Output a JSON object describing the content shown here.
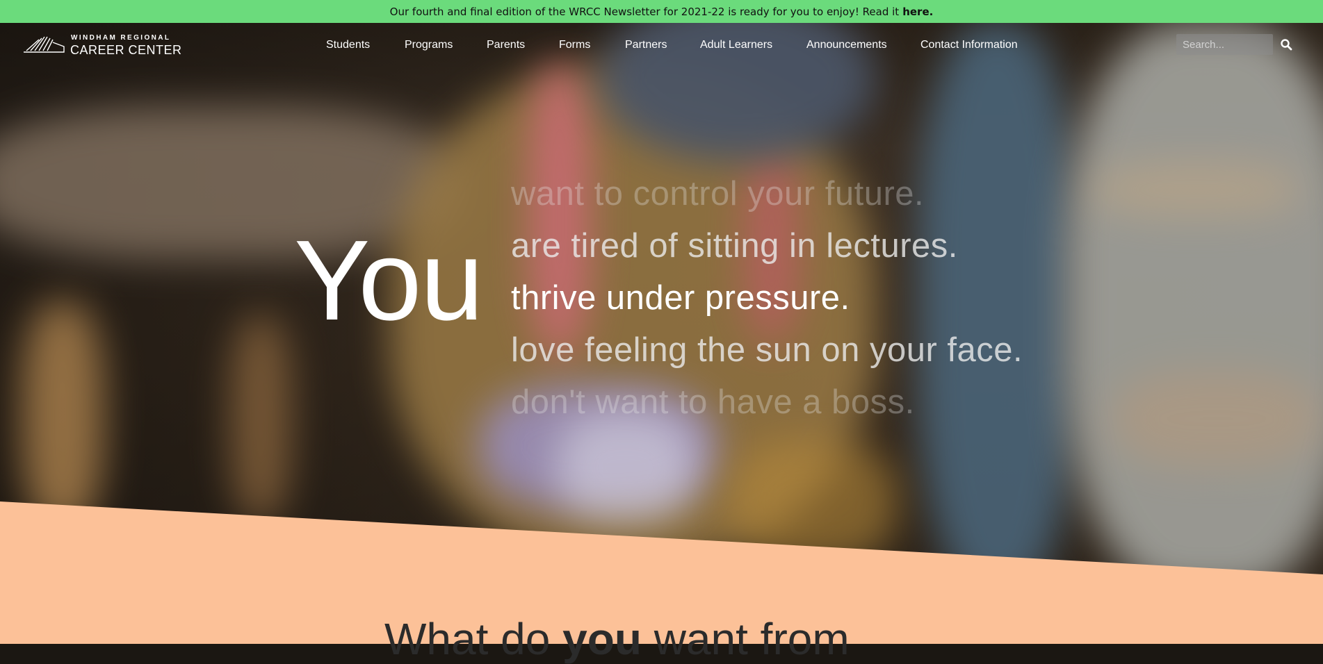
{
  "announcement": {
    "text": "Our fourth and final edition of the WRCC Newsletter for 2021-22 is ready for you to enjoy!  Read it",
    "link_text": "here."
  },
  "logo": {
    "top_line": "WINDHAM REGIONAL",
    "bottom_line": "CAREER CENTER"
  },
  "nav": {
    "items": [
      {
        "label": "Students"
      },
      {
        "label": "Programs"
      },
      {
        "label": "Parents"
      },
      {
        "label": "Forms"
      },
      {
        "label": "Partners"
      },
      {
        "label": "Adult Learners"
      },
      {
        "label": "Announcements"
      },
      {
        "label": "Contact Information"
      }
    ]
  },
  "search": {
    "placeholder": "Search...",
    "icon": "search-icon"
  },
  "hero": {
    "big_word": "You",
    "phrases": [
      "want to control your future.",
      "are tired of sitting in lectures.",
      "thrive under pressure.",
      "love feeling the sun on your face.",
      "don't want to have a boss."
    ]
  },
  "section": {
    "question_pre": "What do",
    "question_bold": "you",
    "question_post": "want from"
  },
  "colors": {
    "announcement_bg": "#6bdb7c",
    "peach_section_bg": "#fcc198",
    "text_white": "#ffffff"
  }
}
